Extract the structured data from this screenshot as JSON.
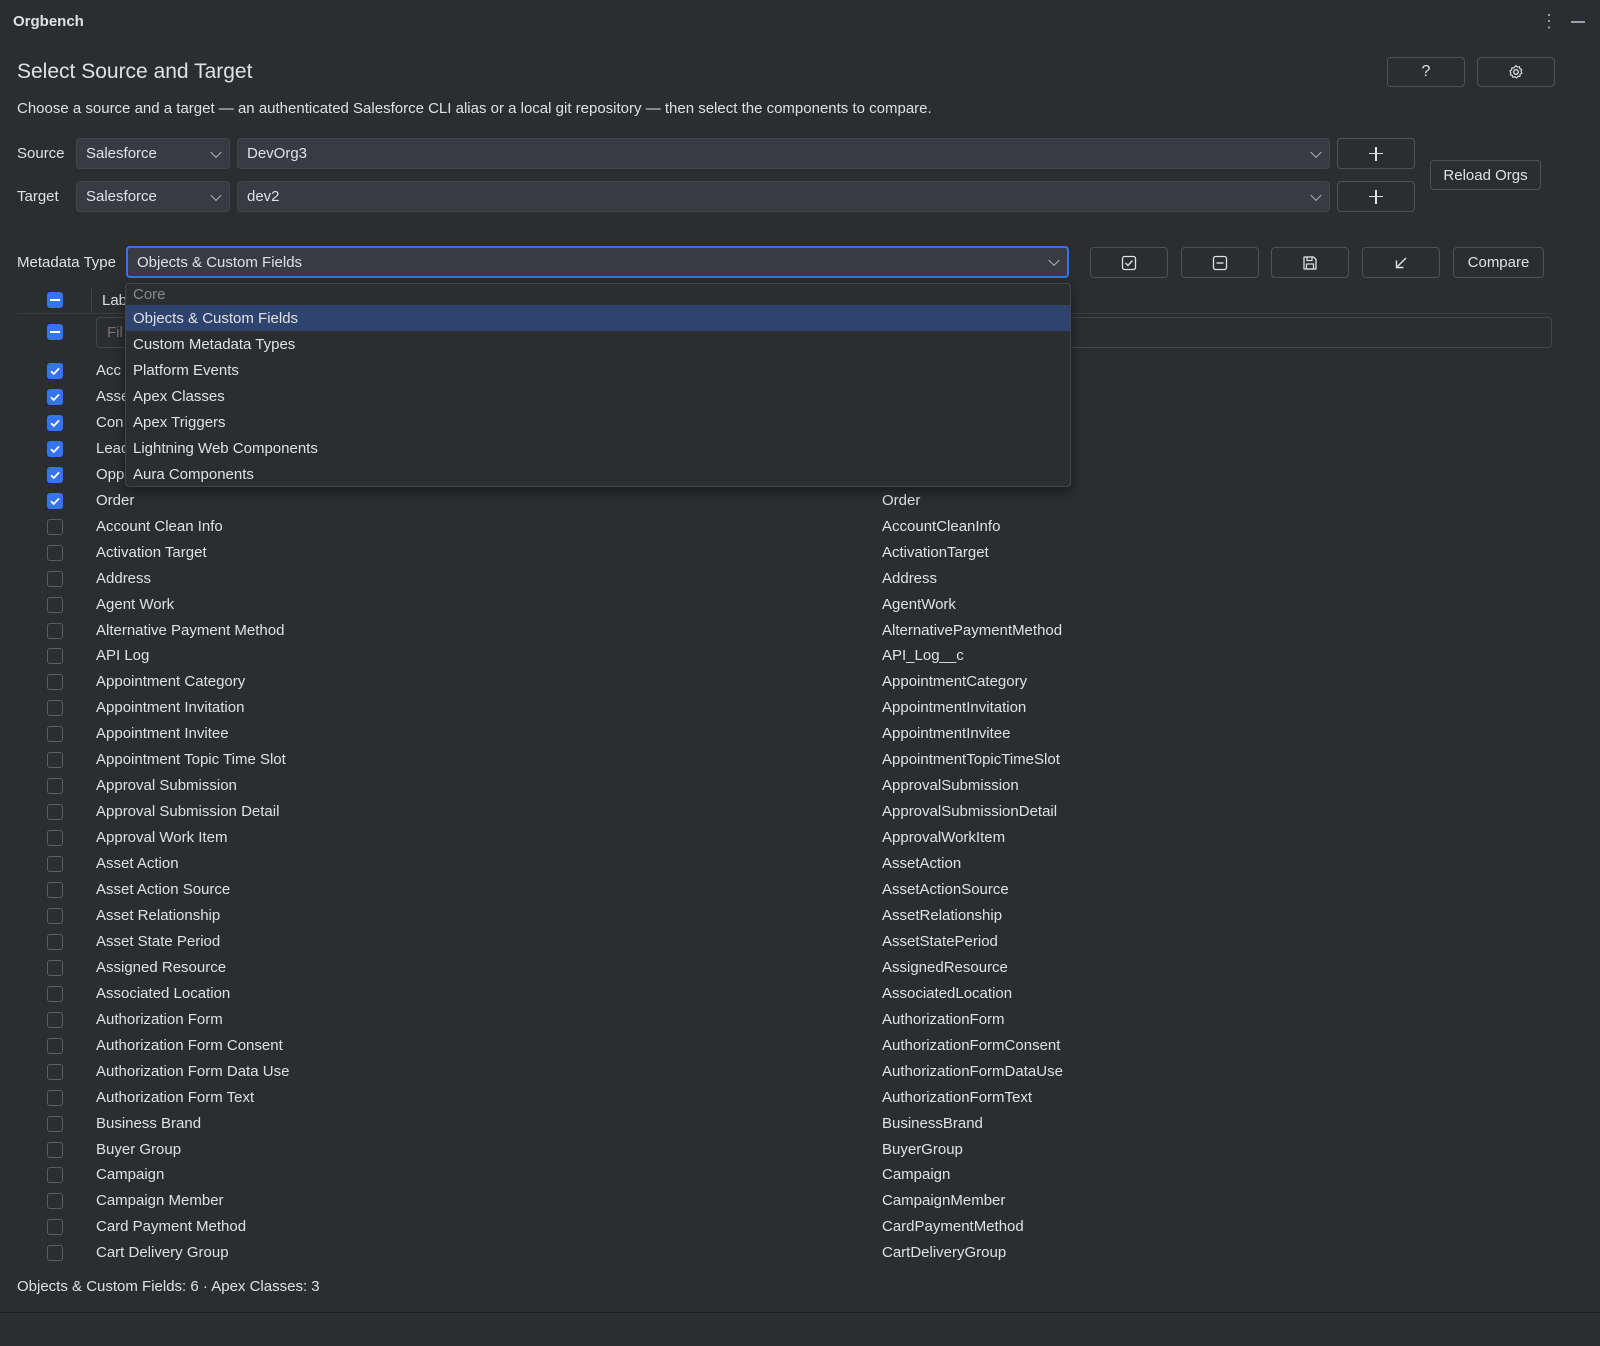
{
  "app": {
    "title": "Orgbench"
  },
  "header": {
    "title": "Select Source and Target",
    "description": "Choose a source and a target — an authenticated Salesforce CLI alias or a local git repository — then select the components to compare.",
    "help_label": "?"
  },
  "source": {
    "label": "Source",
    "type": "Salesforce",
    "org": "DevOrg3"
  },
  "target": {
    "label": "Target",
    "type": "Salesforce",
    "org": "dev2"
  },
  "reload_label": "Reload Orgs",
  "metadata": {
    "label": "Metadata Type",
    "selected": "Objects & Custom Fields"
  },
  "compare_label": "Compare",
  "table": {
    "header_label": "Lab",
    "filter_placeholder": "Fil",
    "rows": [
      {
        "label": "Acc",
        "api": "",
        "checked": true
      },
      {
        "label": "Asse",
        "api": "",
        "checked": true
      },
      {
        "label": "Con",
        "api": "",
        "checked": true
      },
      {
        "label": "Lead",
        "api": "",
        "checked": true
      },
      {
        "label": "Opp",
        "api": "",
        "checked": true
      },
      {
        "label": "Order",
        "api": "Order",
        "checked": true
      },
      {
        "label": "Account Clean Info",
        "api": "AccountCleanInfo",
        "checked": false
      },
      {
        "label": "Activation Target",
        "api": "ActivationTarget",
        "checked": false
      },
      {
        "label": "Address",
        "api": "Address",
        "checked": false
      },
      {
        "label": "Agent Work",
        "api": "AgentWork",
        "checked": false
      },
      {
        "label": "Alternative Payment Method",
        "api": "AlternativePaymentMethod",
        "checked": false
      },
      {
        "label": "API Log",
        "api": "API_Log__c",
        "checked": false
      },
      {
        "label": "Appointment Category",
        "api": "AppointmentCategory",
        "checked": false
      },
      {
        "label": "Appointment Invitation",
        "api": "AppointmentInvitation",
        "checked": false
      },
      {
        "label": "Appointment Invitee",
        "api": "AppointmentInvitee",
        "checked": false
      },
      {
        "label": "Appointment Topic Time Slot",
        "api": "AppointmentTopicTimeSlot",
        "checked": false
      },
      {
        "label": "Approval Submission",
        "api": "ApprovalSubmission",
        "checked": false
      },
      {
        "label": "Approval Submission Detail",
        "api": "ApprovalSubmissionDetail",
        "checked": false
      },
      {
        "label": "Approval Work Item",
        "api": "ApprovalWorkItem",
        "checked": false
      },
      {
        "label": "Asset Action",
        "api": "AssetAction",
        "checked": false
      },
      {
        "label": "Asset Action Source",
        "api": "AssetActionSource",
        "checked": false
      },
      {
        "label": "Asset Relationship",
        "api": "AssetRelationship",
        "checked": false
      },
      {
        "label": "Asset State Period",
        "api": "AssetStatePeriod",
        "checked": false
      },
      {
        "label": "Assigned Resource",
        "api": "AssignedResource",
        "checked": false
      },
      {
        "label": "Associated Location",
        "api": "AssociatedLocation",
        "checked": false
      },
      {
        "label": "Authorization Form",
        "api": "AuthorizationForm",
        "checked": false
      },
      {
        "label": "Authorization Form Consent",
        "api": "AuthorizationFormConsent",
        "checked": false
      },
      {
        "label": "Authorization Form Data Use",
        "api": "AuthorizationFormDataUse",
        "checked": false
      },
      {
        "label": "Authorization Form Text",
        "api": "AuthorizationFormText",
        "checked": false
      },
      {
        "label": "Business Brand",
        "api": "BusinessBrand",
        "checked": false
      },
      {
        "label": "Buyer Group",
        "api": "BuyerGroup",
        "checked": false
      },
      {
        "label": "Campaign",
        "api": "Campaign",
        "checked": false
      },
      {
        "label": "Campaign Member",
        "api": "CampaignMember",
        "checked": false
      },
      {
        "label": "Card Payment Method",
        "api": "CardPaymentMethod",
        "checked": false
      },
      {
        "label": "Cart Delivery Group",
        "api": "CartDeliveryGroup",
        "checked": false
      }
    ]
  },
  "dropdown": {
    "group": "Core",
    "items": [
      "Objects & Custom Fields",
      "Custom Metadata Types",
      "Platform Events",
      "Apex Classes",
      "Apex Triggers",
      "Lightning Web Components",
      "Aura Components"
    ],
    "selected_index": 0
  },
  "status": "Objects & Custom Fields: 6 · Apex Classes: 3",
  "colors": {
    "accent": "#3574f0",
    "background": "#2b2d30",
    "selection": "#2e436e"
  }
}
